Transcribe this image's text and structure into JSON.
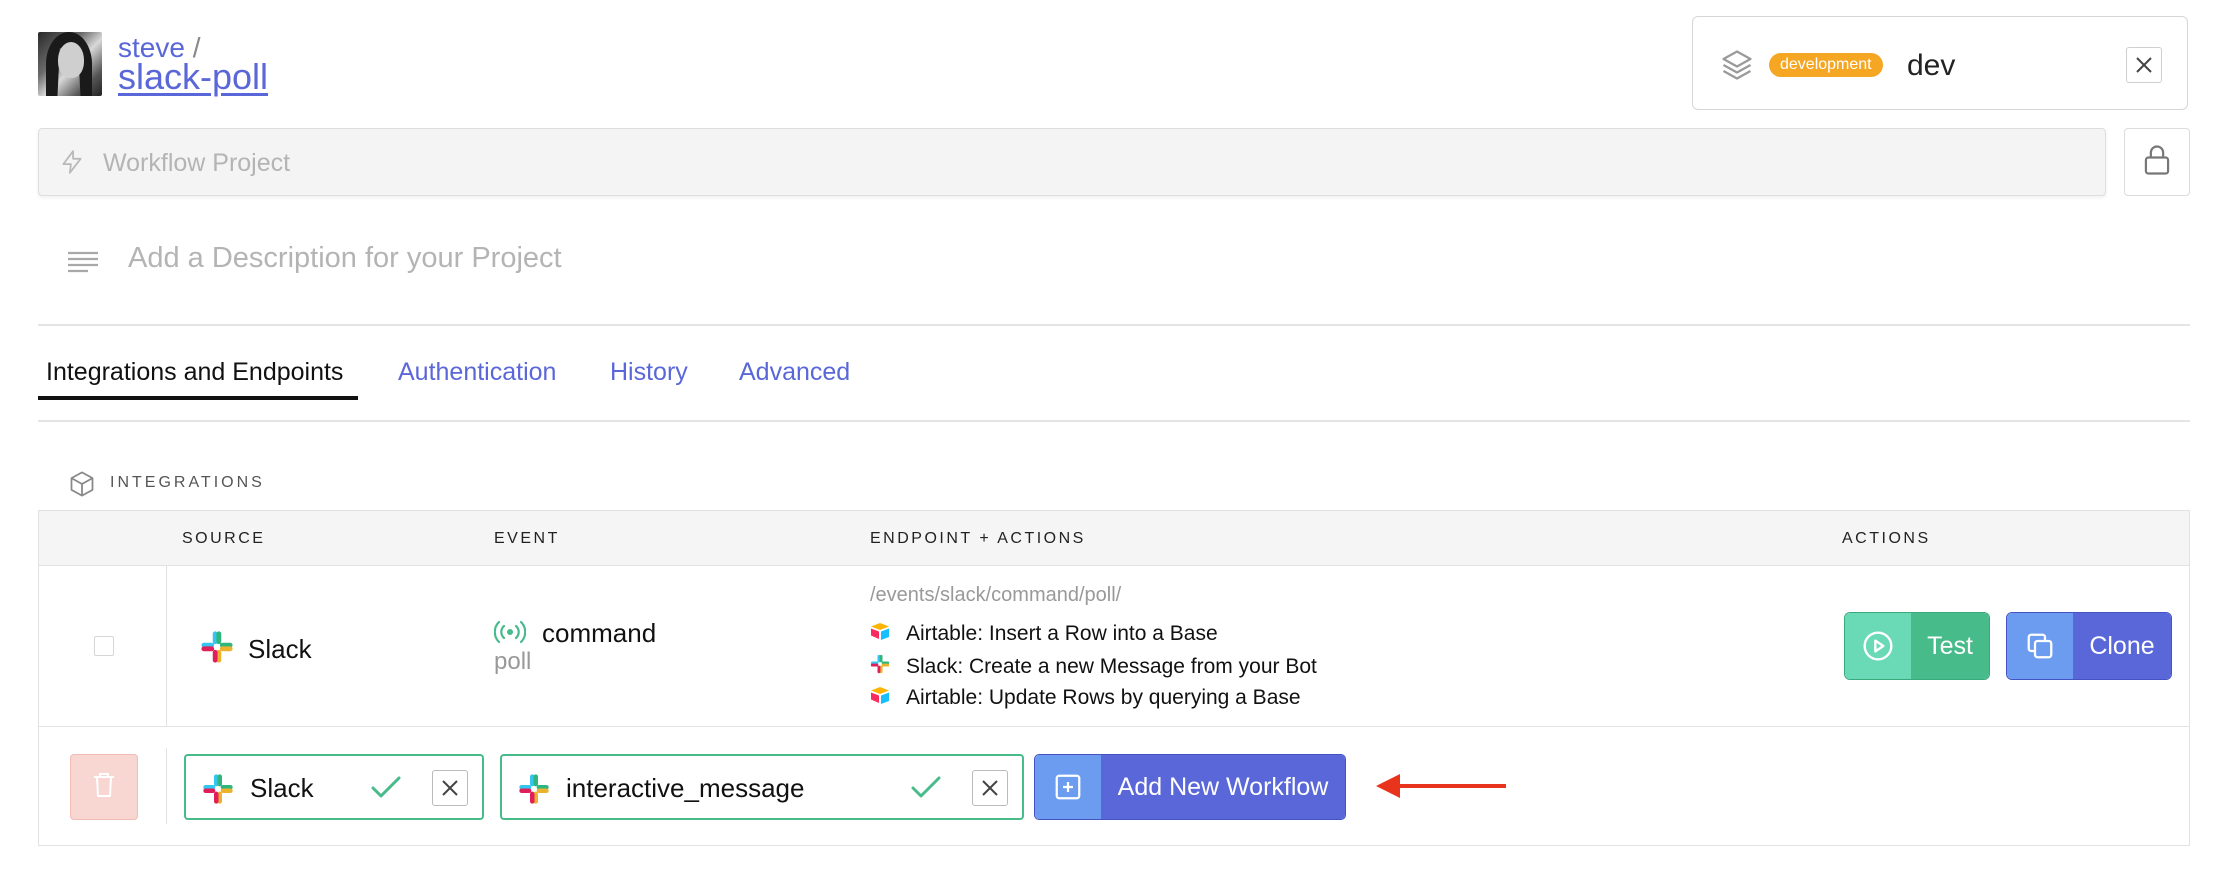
{
  "header": {
    "owner": "steve",
    "separator": "/",
    "project": "slack-poll"
  },
  "environment": {
    "badge": "development",
    "name": "dev",
    "badge_color": "#f5a623"
  },
  "project_input": {
    "placeholder": "Workflow Project",
    "value": ""
  },
  "description": {
    "placeholder": "Add a Description for your Project"
  },
  "tabs": [
    {
      "label": "Integrations and Endpoints",
      "active": true
    },
    {
      "label": "Authentication",
      "active": false
    },
    {
      "label": "History",
      "active": false
    },
    {
      "label": "Advanced",
      "active": false
    }
  ],
  "integrations": {
    "section_title": "INTEGRATIONS",
    "columns": [
      "SOURCE",
      "EVENT",
      "ENDPOINT + ACTIONS",
      "ACTIONS"
    ],
    "rows": [
      {
        "source": "Slack",
        "event": "command",
        "event_sub": "poll",
        "endpoint": "/events/slack/command/poll/",
        "actions": [
          {
            "icon": "airtable-icon",
            "label": "Airtable: Insert a Row into a Base"
          },
          {
            "icon": "slack-icon",
            "label": "Slack: Create a new Message from your Bot"
          },
          {
            "icon": "airtable-icon",
            "label": "Airtable: Update Rows by querying a Base"
          }
        ],
        "test_label": "Test",
        "clone_label": "Clone"
      }
    ],
    "new_workflow": {
      "source": "Slack",
      "event": "interactive_message",
      "add_label": "Add New Workflow"
    }
  },
  "colors": {
    "accent": "#5a67d8",
    "success": "#48bb8a",
    "danger_soft": "#f8d7d3",
    "arrow": "#e8341c"
  }
}
